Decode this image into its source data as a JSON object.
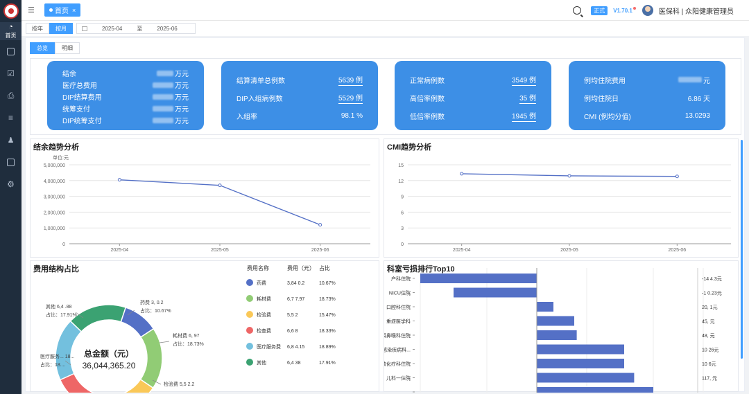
{
  "sidebar": {
    "home_label": "首页"
  },
  "topbar": {
    "tab_home": "首页",
    "tab_close": "×",
    "env_badge": "正式",
    "version": "V1.70.1",
    "user": "医保科 | 众阳健康管理员"
  },
  "filters": {
    "by_year": "按年",
    "by_month": "按月",
    "date_start": "2025-04",
    "date_sep": "至",
    "date_end": "2025-06"
  },
  "view_tabs": {
    "overview": "总览",
    "detail": "明细"
  },
  "cards": [
    {
      "rows": [
        {
          "label": "结余",
          "value": "万元"
        },
        {
          "label": "医疗总费用",
          "value": "万元"
        },
        {
          "label": "DIP结算费用",
          "value": "万元"
        },
        {
          "label": "统筹支付",
          "value": "万元"
        },
        {
          "label": "DIP统筹支付",
          "value": "万元"
        }
      ]
    },
    {
      "rows": [
        {
          "label": "结算清单总例数",
          "value": "5639 例"
        },
        {
          "label": "DIP入组病例数",
          "value": "5529 例"
        },
        {
          "label": "入组率",
          "value": "98.1 %"
        }
      ]
    },
    {
      "rows": [
        {
          "label": "正常病例数",
          "value": "3549 例"
        },
        {
          "label": "高倍率例数",
          "value": "35 例"
        },
        {
          "label": "低倍率例数",
          "value": "1945 例"
        }
      ]
    },
    {
      "rows": [
        {
          "label": "例均住院费用",
          "value": "元"
        },
        {
          "label": "例均住院日",
          "value": "6.86 天"
        },
        {
          "label": "CMI (例均分值)",
          "value": "13.0293"
        }
      ]
    }
  ],
  "chart_data": [
    {
      "type": "line",
      "title": "结余趋势分析",
      "ylabel": "单位:元",
      "categories": [
        "2025-04",
        "2025-05",
        "2025-06"
      ],
      "values": [
        4050000,
        3700000,
        1200000
      ],
      "ylim": [
        0,
        5000000
      ],
      "yticks": [
        "0",
        "1,000,000",
        "2,000,000",
        "3,000,000",
        "4,000,000",
        "5,000,000"
      ],
      "color": "#5470c6"
    },
    {
      "type": "line",
      "title": "CMI趋势分析",
      "categories": [
        "2025-04",
        "2025-05",
        "2025-06"
      ],
      "values": [
        13.3,
        12.9,
        12.8
      ],
      "ylim": [
        0,
        15
      ],
      "yticks": [
        "0",
        "3",
        "6",
        "9",
        "12",
        "15"
      ],
      "color": "#5470c6"
    },
    {
      "type": "pie",
      "title": "费用结构占比",
      "center_title": "总金额（元）",
      "center_value": "36,044,365.20",
      "table_headers": [
        "费用名称",
        "费用（元）",
        "占比"
      ],
      "slices": [
        {
          "name": "药费",
          "amount": "3,84",
          "amount_tail": "0.2",
          "pct": "10.67%",
          "value": 10.67,
          "color": "#5470c6",
          "callout": "药费 3,",
          "callout_tail": "0.2"
        },
        {
          "name": "耗材费",
          "amount": "6,7",
          "amount_tail": "7.97",
          "pct": "18.73%",
          "value": 18.73,
          "color": "#91cc75",
          "callout": "耗材费 6,",
          "callout_tail": "97"
        },
        {
          "name": "检验费",
          "amount": "5,5",
          "amount_tail": "2",
          "pct": "15.47%",
          "value": 15.47,
          "color": "#fac858",
          "callout": "检验费 5,5",
          "callout_tail": "2.2"
        },
        {
          "name": "检查费",
          "amount": "6,6",
          "amount_tail": "8",
          "pct": "18.33%",
          "value": 18.33,
          "color": "#ee6666",
          "callout": "",
          "callout_tail": ""
        },
        {
          "name": "医疗服务费",
          "amount": "6,8",
          "amount_tail": "4.15",
          "pct": "18.89%",
          "value": 18.89,
          "color": "#73c0de",
          "callout": "医疗服务...",
          "callout_tail": "18..."
        },
        {
          "name": "其他",
          "amount": "6,4",
          "amount_tail": "38",
          "pct": "17.91%",
          "value": 17.91,
          "color": "#3ba272",
          "callout": "其他 6,4",
          "callout_tail": ".88"
        }
      ],
      "callout_pct_prefix": "占比："
    },
    {
      "type": "bar",
      "orientation": "horizontal",
      "title": "科室亏损排行Top10",
      "categories": [
        "产科住院",
        "NICU住院",
        "口腔科住院",
        "重症医学科",
        "耳鼻喉科住院",
        "感染疾病科...",
        "放化疗科住院",
        "儿科一住院",
        "..."
      ],
      "values": [
        -140,
        -100,
        20,
        45,
        48,
        105,
        105,
        117,
        140
      ],
      "right_labels": [
        "-14",
        "-1",
        "20,",
        "45,",
        "48,",
        "10",
        "10",
        "117,",
        ""
      ],
      "right_label_tails": [
        "4.3元",
        "0.23元",
        "1元",
        "元",
        "元",
        "26元",
        "6元",
        "元",
        ""
      ],
      "color": "#5470c6"
    }
  ]
}
